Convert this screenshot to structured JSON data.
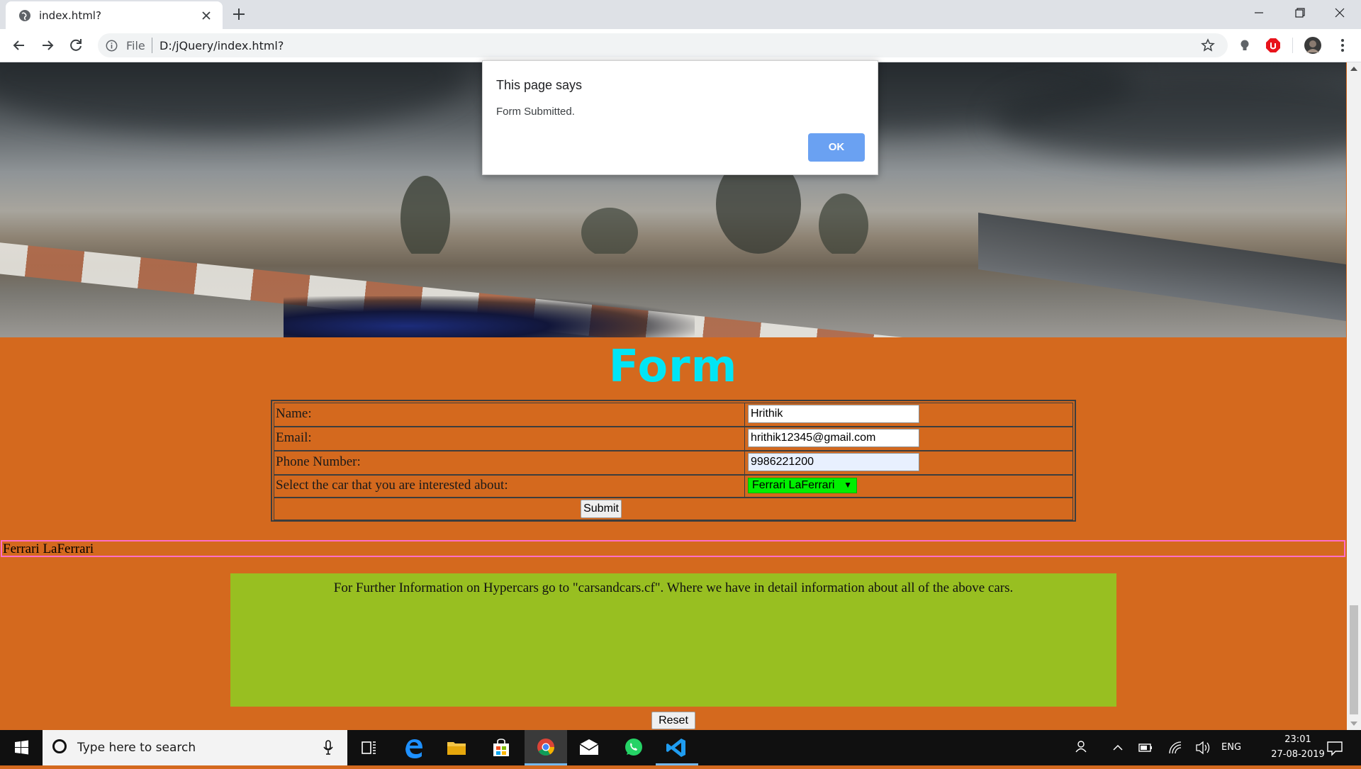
{
  "browser": {
    "tab_title": "index.html?",
    "url_scheme": "File",
    "url": "D:/jQuery/index.html?"
  },
  "page": {
    "form_title": "Form",
    "fields": [
      {
        "label": "Name:",
        "value": "Hrithik"
      },
      {
        "label": "Email:",
        "value": "hrithik12345@gmail.com"
      },
      {
        "label": "Phone Number:",
        "value": "9986221200"
      }
    ],
    "car_select": {
      "label": "Select the car that you are interested about:",
      "selected": "Ferrari LaFerrari",
      "color": "#00f000"
    },
    "submit_label": "Submit",
    "output_text": "Ferrari LaFerrari",
    "info_text": "For Further Information on Hypercars go to \"carsandcars.cf\". Where we have in detail information about all of the above cars.",
    "reset_label": "Reset",
    "colors": {
      "background": "#d4691e",
      "title": "#00e5f5",
      "info_box": "#98bf21",
      "output_border": "#ff6fc8"
    }
  },
  "dialog": {
    "heading": "This page says",
    "message": "Form Submitted.",
    "ok_label": "OK"
  },
  "taskbar": {
    "search_placeholder": "Type here to search",
    "language": "ENG",
    "time": "23:01",
    "date": "27-08-2019",
    "apps": [
      "task-view-icon",
      "edge-icon",
      "file-explorer-icon",
      "store-icon",
      "chrome-icon",
      "mail-icon",
      "whatsapp-icon",
      "vscode-icon"
    ]
  }
}
